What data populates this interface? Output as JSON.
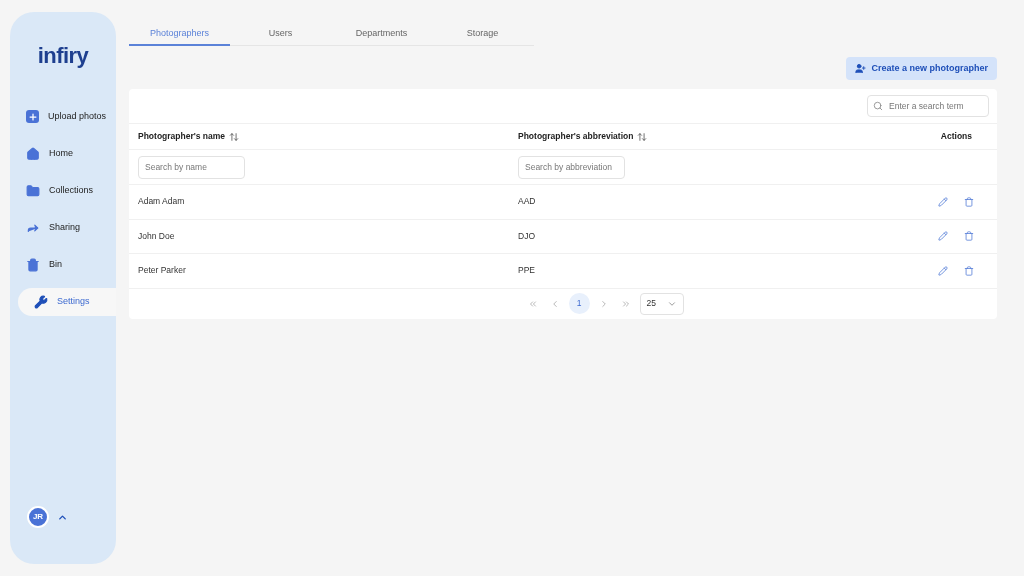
{
  "logo": "infiry",
  "sidebar": {
    "items": [
      {
        "label": "Upload photos",
        "selected": false
      },
      {
        "label": "Home",
        "selected": false
      },
      {
        "label": "Collections",
        "selected": false
      },
      {
        "label": "Sharing",
        "selected": false
      },
      {
        "label": "Bin",
        "selected": false
      },
      {
        "label": "Settings",
        "selected": true
      }
    ],
    "user": {
      "initials": "JR"
    }
  },
  "tabs": [
    {
      "label": "Photographers",
      "selected": true
    },
    {
      "label": "Users",
      "selected": false
    },
    {
      "label": "Departments",
      "selected": false
    },
    {
      "label": "Storage",
      "selected": false
    }
  ],
  "create_button": "Create a new photographer",
  "search": {
    "placeholder": "Enter a search term"
  },
  "table": {
    "columns": [
      {
        "label": "Photographer's name",
        "filter_placeholder": "Search by name"
      },
      {
        "label": "Photographer's abbreviation",
        "filter_placeholder": "Search by abbreviation"
      },
      {
        "label": "Actions"
      }
    ],
    "rows": [
      {
        "name": "Adam Adam",
        "abbreviation": "AAD"
      },
      {
        "name": "John Doe",
        "abbreviation": "DJO"
      },
      {
        "name": "Peter Parker",
        "abbreviation": "PPE"
      }
    ]
  },
  "pagination": {
    "pages": [
      {
        "label": "1",
        "selected": true
      }
    ],
    "page_size": "25"
  }
}
